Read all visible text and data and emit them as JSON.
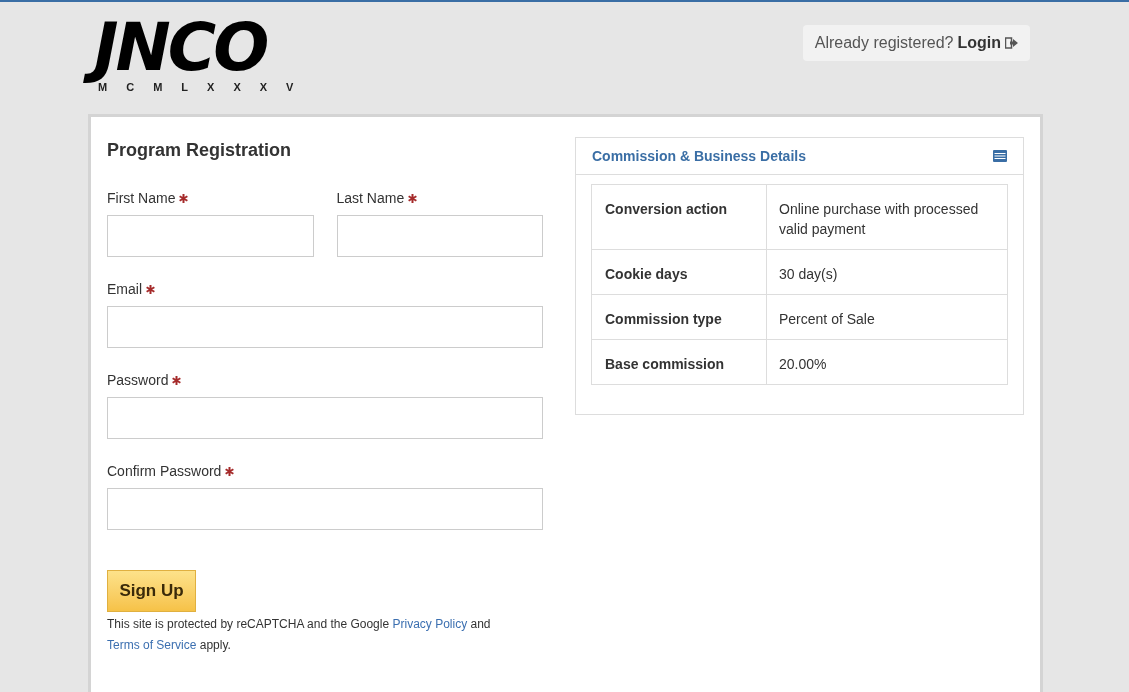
{
  "logo": {
    "wordmark": "JNCO",
    "numerals": [
      "M",
      "C",
      "M",
      "L",
      "X",
      "X",
      "X",
      "V"
    ]
  },
  "login_prompt": {
    "text": "Already registered?",
    "link": "Login"
  },
  "form": {
    "title": "Program Registration",
    "name_fields": [
      {
        "label": "First Name",
        "required": true
      },
      {
        "label": "Last Name",
        "required": true
      }
    ],
    "fields": [
      {
        "label": "Email",
        "required": true
      },
      {
        "label": "Password",
        "required": true
      },
      {
        "label": "Confirm Password",
        "required": true
      }
    ],
    "submit": "Sign Up",
    "notice": [
      {
        "kind": "text",
        "text": "This site is protected by reCAPTCHA and the Google"
      },
      {
        "kind": "link",
        "text": "Privacy Policy"
      },
      {
        "kind": "text",
        "text": "and"
      },
      {
        "kind": "link",
        "text": "Terms of Service"
      },
      {
        "kind": "text",
        "text": "apply."
      }
    ]
  },
  "details": {
    "title": "Commission & Business Details",
    "rows": [
      {
        "label": "Conversion action",
        "value": "Online purchase with processed valid payment"
      },
      {
        "label": "Cookie days",
        "value": "30 day(s)"
      },
      {
        "label": "Commission type",
        "value": "Percent of Sale"
      },
      {
        "label": "Base commission",
        "value": "20.00%"
      }
    ]
  }
}
